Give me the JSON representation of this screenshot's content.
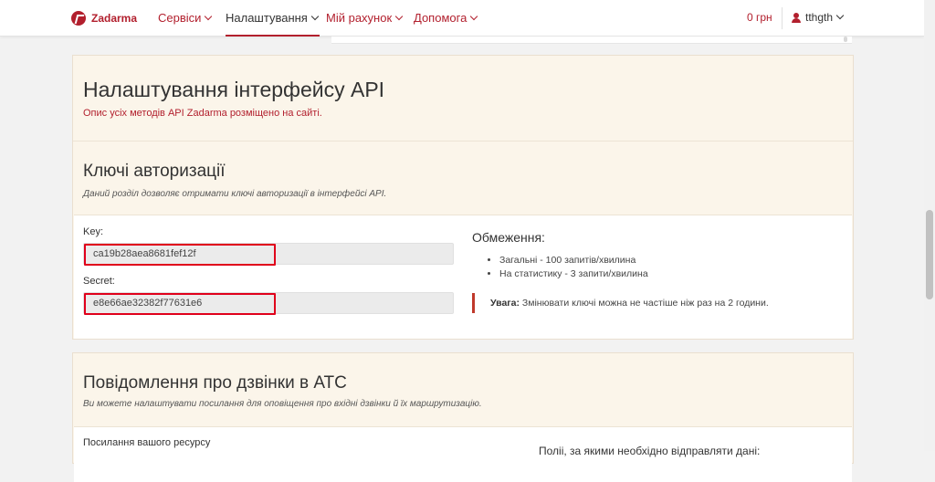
{
  "header": {
    "logo_text": "Zadarma",
    "nav": [
      {
        "label": "Сервіси"
      },
      {
        "label": "Налаштування"
      },
      {
        "label": "Мій рахунок"
      },
      {
        "label": "Допомога"
      }
    ],
    "balance": "0 грн",
    "username": "tthgth"
  },
  "api": {
    "title": "Налаштування інтерфейсу API",
    "subtitle": "Опис усіх методів API Zadarma розміщено на сайті."
  },
  "auth": {
    "title": "Ключі авторизації",
    "description": "Даний розділ дозволяє отримати ключі авторизації в інтерфейсі API.",
    "key_label": "Key:",
    "key_value": "ca19b28aea8681fef12f",
    "secret_label": "Secret:",
    "secret_value": "e8e66ae32382f77631e6"
  },
  "limits": {
    "title": "Обмеження:",
    "items": [
      "Загальні - 100 запитів/хвилина",
      "На статистику - 3 запити/хвилина"
    ],
    "warning_bold": "Увага:",
    "warning_text": " Змінювати ключі можна не частіше ніж раз на 2 години."
  },
  "notifications": {
    "title": "Повідомлення про дзвінки в АТС",
    "description": "Ви можете налаштувати посилання для оповіщення про вхідні дзвінки й їх маршрутизацію.",
    "link_label": "Посилання вашого ресурсу",
    "fields_label": "Поліі, за якими необхідно відправляти дані:"
  },
  "colors": {
    "accent": "#b21f2d",
    "panel_bg": "#fbf5ea",
    "highlight": "#e0001b"
  }
}
